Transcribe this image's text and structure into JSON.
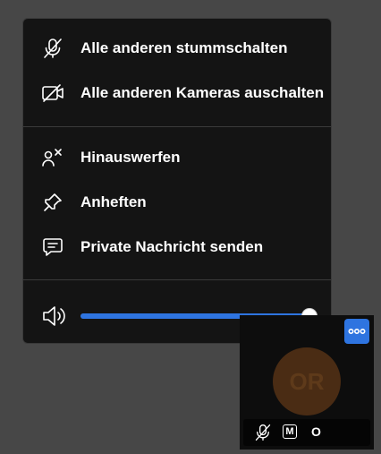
{
  "menu": {
    "items": [
      {
        "icon": "mic-off-icon",
        "label": "Alle anderen stummschalten"
      },
      {
        "icon": "camera-off-icon",
        "label": "Alle anderen Kameras auschalten"
      },
      {
        "icon": "user-remove-icon",
        "label": "Hinauswerfen"
      },
      {
        "icon": "pin-icon",
        "label": "Anheften"
      },
      {
        "icon": "chat-icon",
        "label": "Private Nachricht senden"
      }
    ],
    "volume": {
      "icon": "speaker-icon",
      "level": 1.0
    }
  },
  "tile": {
    "avatar_initials": "OR",
    "moderator_badge": "M",
    "name": "O",
    "colors": {
      "accent": "#2e74e0",
      "avatar": "#4a2c14"
    }
  }
}
